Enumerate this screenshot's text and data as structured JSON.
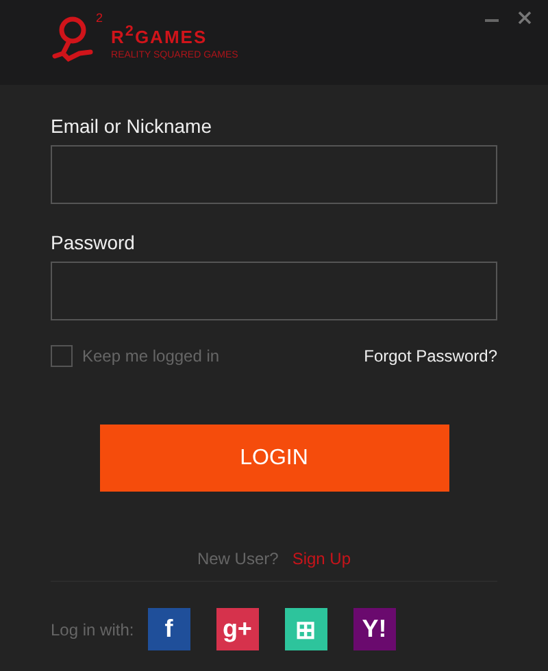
{
  "window": {
    "controls": [
      {
        "kind": "minimize"
      },
      {
        "kind": "close"
      }
    ]
  },
  "logo": {
    "superscript": "2",
    "name": "R$^{2}$GAMES",
    "tagline": "REALITY SQUARED GAMES"
  },
  "fields": [
    {
      "label": "Email or Nickname"
    },
    {
      "label": "Password"
    }
  ],
  "remember": {
    "label": "Keep me logged in",
    "checked": false
  },
  "forgot": "Forgot Password?",
  "login_button": "LOGIN",
  "signup": {
    "prompt": "New User?",
    "link": "Sign Up"
  },
  "social": {
    "label": "Log in with:",
    "providers": [
      {
        "glyph": "f",
        "color": "#1f4f9a"
      },
      {
        "glyph": "g+",
        "color": "#d6324c"
      },
      {
        "glyph": "⊞",
        "color": "#2dc49c"
      },
      {
        "glyph": "Y!",
        "color": "#6a0a6e"
      }
    ]
  }
}
